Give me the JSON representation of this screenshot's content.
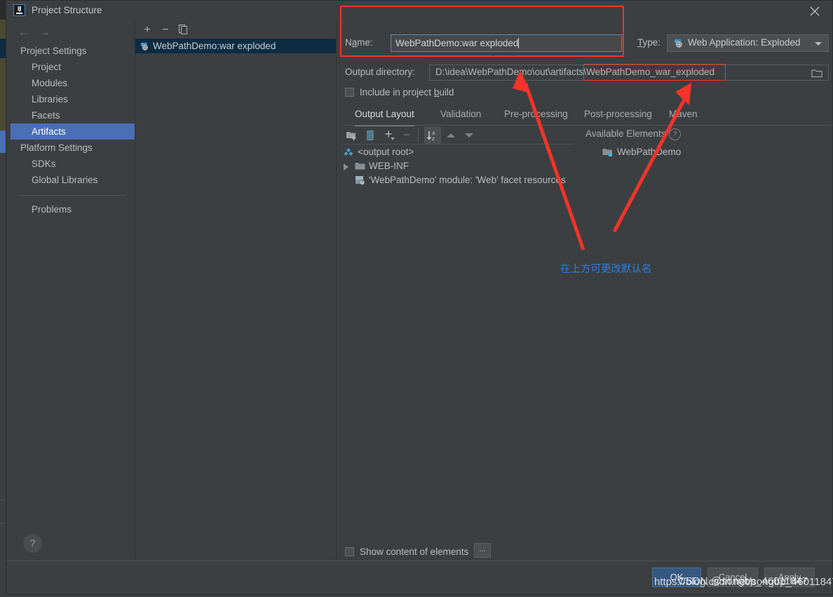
{
  "window": {
    "title": "Project Structure",
    "logo_text": "IJ",
    "close_icon": "close-icon"
  },
  "nav": {
    "back_icon": "arrow-left-icon",
    "forward_icon": "arrow-right-icon",
    "items": [
      {
        "label": "Project Settings",
        "type": "group",
        "selected": false
      },
      {
        "label": "Project",
        "type": "child",
        "selected": false
      },
      {
        "label": "Modules",
        "type": "child",
        "selected": false
      },
      {
        "label": "Libraries",
        "type": "child",
        "selected": false
      },
      {
        "label": "Facets",
        "type": "child",
        "selected": false
      },
      {
        "label": "Artifacts",
        "type": "child",
        "selected": true
      },
      {
        "label": "Platform Settings",
        "type": "group",
        "selected": false
      },
      {
        "label": "SDKs",
        "type": "child",
        "selected": false
      },
      {
        "label": "Global Libraries",
        "type": "child",
        "selected": false
      }
    ],
    "after_separator": [
      {
        "label": "Problems",
        "type": "child",
        "selected": false
      }
    ],
    "help_label": "?"
  },
  "artifacts_panel": {
    "toolbar": [
      {
        "name": "add-artifact-button",
        "glyph": "+"
      },
      {
        "name": "remove-artifact-button",
        "glyph": "−"
      },
      {
        "name": "copy-artifact-button",
        "glyph": "copy-icon"
      }
    ],
    "selected_artifact": "WebPathDemo:war exploded",
    "artifact_icon": "artifact-icon"
  },
  "form": {
    "name_label": "Name:",
    "name_value": "WebPathDemo:war exploded",
    "type_label": "Type:",
    "type_value": "Web Application: Exploded",
    "type_icon": "artifact-icon",
    "output_dir_label": "Output directory:",
    "output_dir_value": "D:\\idea\\WebPathDemo\\out\\artifacts\\WebPathDemo_war_exploded",
    "output_dir_prefix": "D:\\idea\\WebPathDemo\\out\\artifacts\\",
    "output_dir_highlight": "WebPathDemo_war_exploded",
    "browse_icon": "folder-icon",
    "include_in_build_label": "Include in project build",
    "include_in_build_checked": false
  },
  "tabs": [
    {
      "label": "Output Layout",
      "active": true
    },
    {
      "label": "Validation",
      "active": false
    },
    {
      "label": "Pre-processing",
      "active": false
    },
    {
      "label": "Post-processing",
      "active": false
    },
    {
      "label": "Maven",
      "active": false
    }
  ],
  "layout_toolbar": [
    {
      "name": "add-directory-button",
      "glyph": "folder-add-icon"
    },
    {
      "name": "add-archive-button",
      "glyph": "archive-icon"
    },
    {
      "name": "add-element-button",
      "glyph": "plus-dropdown-icon"
    },
    {
      "name": "remove-element-button",
      "glyph": "minus-icon"
    },
    {
      "name": "sort-button",
      "glyph": "sort-az-icon"
    },
    {
      "name": "move-up-button",
      "glyph": "triangle-up-icon"
    },
    {
      "name": "move-down-button",
      "glyph": "triangle-down-icon"
    }
  ],
  "output_tree": [
    {
      "label": "<output root>",
      "icon": "output-root-icon",
      "indent": 0,
      "expandable": false
    },
    {
      "label": "WEB-INF",
      "icon": "folder-icon",
      "indent": 0,
      "expandable": true
    },
    {
      "label": "'WebPathDemo' module: 'Web' facet resources",
      "icon": "facet-resources-icon",
      "indent": 1,
      "expandable": false
    }
  ],
  "available_elements": {
    "header": "Available Elements",
    "help_glyph": "?",
    "items": [
      {
        "label": "WebPathDemo",
        "icon": "module-icon"
      }
    ]
  },
  "bottom": {
    "show_content_label": "Show content of elements",
    "show_content_checked": false,
    "ellipsis_label": "..."
  },
  "footer_buttons": [
    {
      "label": "OK",
      "primary": true
    },
    {
      "label": "Cancel",
      "primary": false
    },
    {
      "label": "Apply",
      "primary": false
    }
  ],
  "annotations": {
    "note_text": "在上方可更改默认名",
    "note_color": "#2b7fe0",
    "highlight_color": "#f5342a",
    "watermark_a": "https://blog.csdn.net/songbp_46011847",
    "watermark_b": "CSDN @songbp_46011847"
  }
}
